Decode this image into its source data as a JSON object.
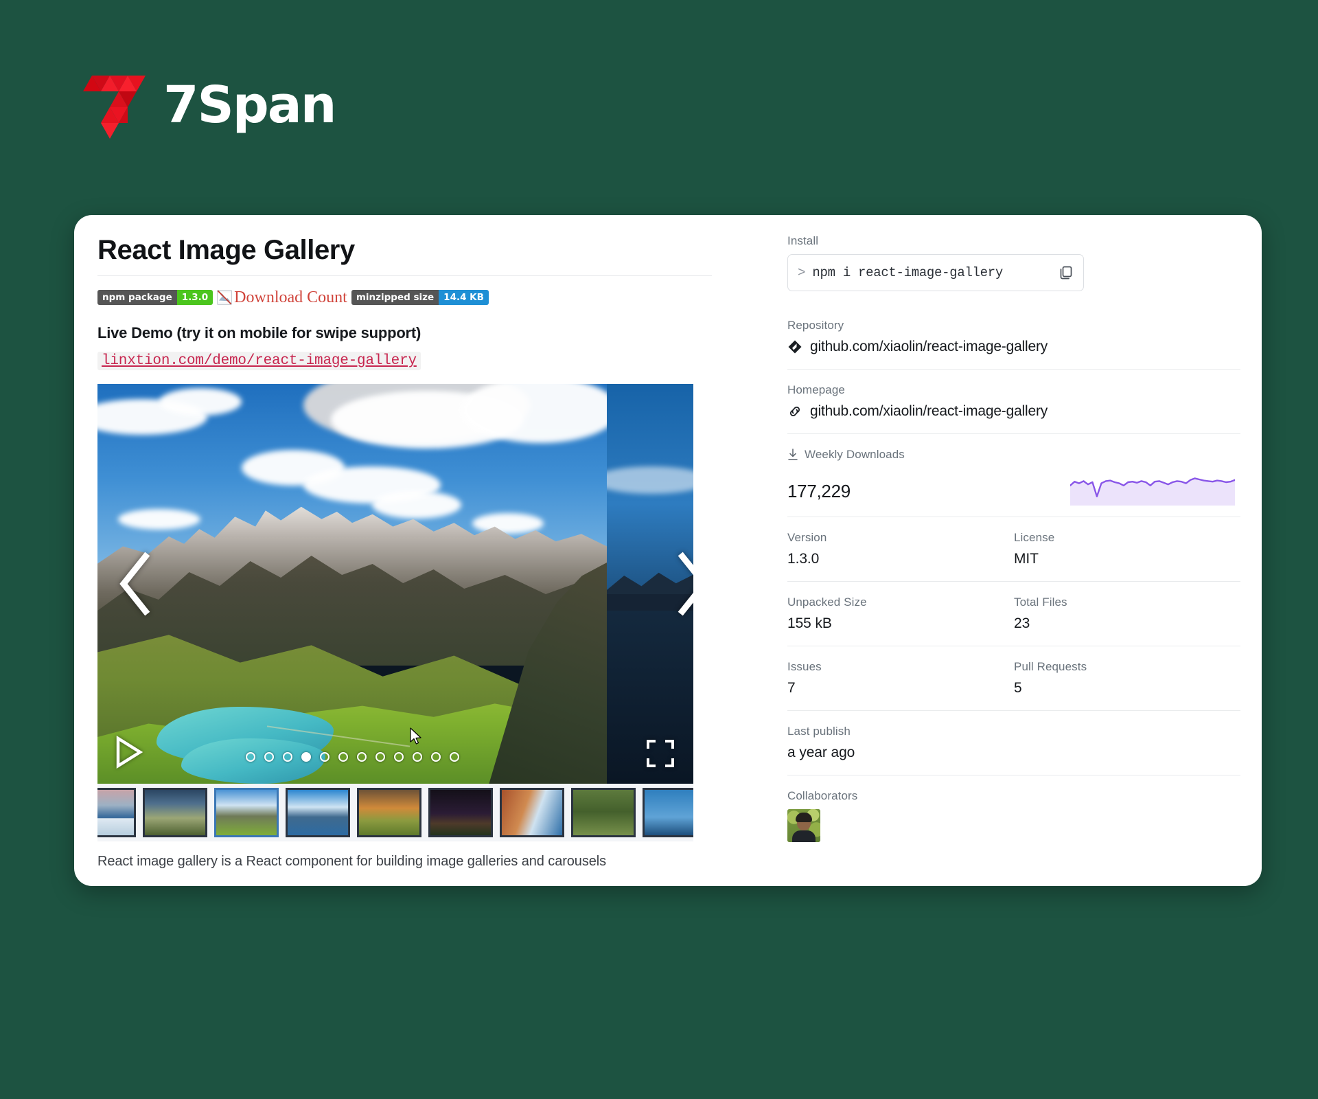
{
  "brand": {
    "name": "7Span",
    "logo_icon": "sevenspan-logo-icon",
    "background_color": "#1d5341",
    "logo_red": "#e01020"
  },
  "readme": {
    "title": "React Image Gallery",
    "badges": [
      {
        "label": "npm package",
        "value": "1.3.0",
        "value_color": "#4bc51d",
        "name": "npm-package-badge"
      },
      {
        "label": "Download Count",
        "value": "",
        "value_color": "",
        "name": "download-count-badge-broken"
      },
      {
        "label": "minzipped size",
        "value": "14.4 KB",
        "value_color": "#1e8fd5",
        "name": "minzipped-size-badge"
      }
    ],
    "broken_image_alt": "Download Count",
    "demo_heading": "Live Demo (try it on mobile for swipe support)",
    "demo_link": "linxtion.com/demo/react-image-gallery",
    "caption": "React image gallery is a React component for building image galleries and carousels"
  },
  "gallery": {
    "prev_icon": "chevron-left-icon",
    "next_icon": "chevron-right-icon",
    "play_icon": "play-icon",
    "fullscreen_icon": "fullscreen-icon",
    "total_slides": 12,
    "active_slide": 4,
    "thumbnails": [
      {
        "name": "thumb-1",
        "selected": false
      },
      {
        "name": "thumb-2",
        "selected": false
      },
      {
        "name": "thumb-3",
        "selected": true
      },
      {
        "name": "thumb-4",
        "selected": false
      },
      {
        "name": "thumb-5",
        "selected": false
      },
      {
        "name": "thumb-6",
        "selected": false
      },
      {
        "name": "thumb-7",
        "selected": false
      },
      {
        "name": "thumb-8",
        "selected": false
      },
      {
        "name": "thumb-9",
        "selected": false
      }
    ]
  },
  "sidebar": {
    "install": {
      "label": "Install",
      "prompt": ">",
      "command": "npm i react-image-gallery",
      "copy_icon": "copy-icon"
    },
    "repository": {
      "label": "Repository",
      "value": "github.com/xiaolin/react-image-gallery",
      "icon": "github-mark-icon"
    },
    "homepage": {
      "label": "Homepage",
      "value": "github.com/xiaolin/react-image-gallery",
      "icon": "link-icon"
    },
    "weekly_downloads": {
      "label": "Weekly Downloads",
      "icon": "download-icon",
      "value": "177,229",
      "spark_color": "#8956e8",
      "spark_fill": "#ece3fb"
    },
    "version": {
      "label": "Version",
      "value": "1.3.0"
    },
    "license": {
      "label": "License",
      "value": "MIT"
    },
    "unpacked_size": {
      "label": "Unpacked Size",
      "value": "155 kB"
    },
    "total_files": {
      "label": "Total Files",
      "value": "23"
    },
    "issues": {
      "label": "Issues",
      "value": "7"
    },
    "pull_requests": {
      "label": "Pull Requests",
      "value": "5"
    },
    "last_publish": {
      "label": "Last publish",
      "value": "a year ago"
    },
    "collaborators": {
      "label": "Collaborators",
      "avatar_name": "collaborator-avatar"
    }
  },
  "chart_data": {
    "type": "line",
    "title": "Weekly Downloads",
    "values": [
      58,
      72,
      66,
      74,
      62,
      70,
      18,
      66,
      74,
      76,
      70,
      66,
      58,
      70,
      72,
      68,
      74,
      70,
      58,
      72,
      74,
      68,
      62,
      70,
      74,
      72,
      66,
      78,
      84,
      80,
      76,
      74,
      72,
      76,
      74,
      70,
      72,
      78
    ],
    "ylim": [
      0,
      100
    ],
    "xlabel": "",
    "ylabel": "",
    "grid": false,
    "legend": false,
    "line_color": "#8956e8",
    "area_color": "#ece3fb"
  }
}
